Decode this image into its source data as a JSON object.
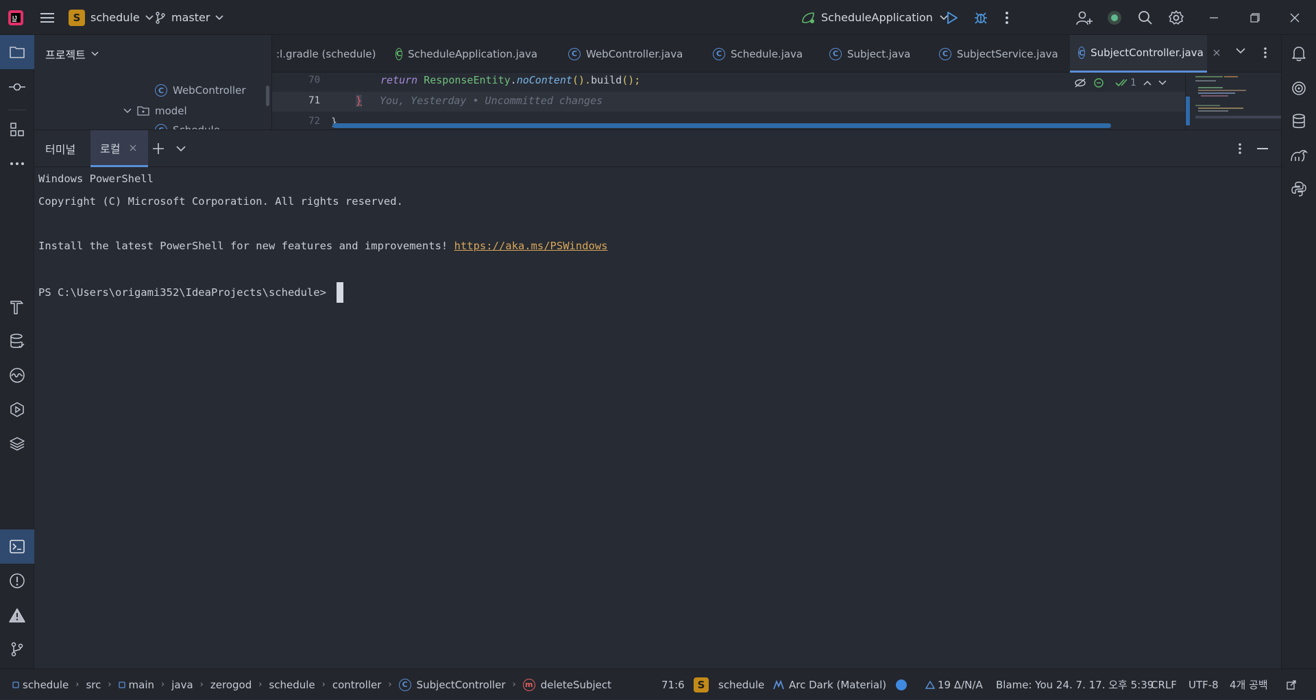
{
  "titlebar": {
    "project_badge": "S",
    "project_name": "schedule",
    "branch": "master",
    "run_config": "ScheduleApplication",
    "icons": [
      "app-logo-icon",
      "hamburger-menu-icon",
      "chevron-down-icon",
      "branch-icon",
      "run-config-icon",
      "run-icon",
      "debug-icon",
      "more-icon",
      "add-user-icon",
      "ai-assistant-icon",
      "search-icon",
      "settings-icon",
      "minimize-icon",
      "restore-icon",
      "close-icon"
    ]
  },
  "project_pane": {
    "title": "프로젝트",
    "tree": [
      {
        "label": "WebController",
        "kind": "class"
      },
      {
        "label": "model",
        "kind": "folder"
      },
      {
        "label": "Schedule",
        "kind": "class"
      }
    ]
  },
  "editor": {
    "tabs": [
      {
        "label": ":l.gradle (schedule)",
        "kind": "gradle"
      },
      {
        "label": "ScheduleApplication.java",
        "kind": "spring"
      },
      {
        "label": "WebController.java",
        "kind": "class"
      },
      {
        "label": "Schedule.java",
        "kind": "class"
      },
      {
        "label": "Subject.java",
        "kind": "class"
      },
      {
        "label": "SubjectService.java",
        "kind": "class"
      },
      {
        "label": "SubjectController.java",
        "kind": "class",
        "active": true
      }
    ],
    "lines": [
      {
        "num": "70",
        "kw": "return",
        "cls": "ResponseEntity",
        "m1": "noContent",
        "rest": "().",
        "m2": "build",
        "end": "();"
      },
      {
        "num": "71",
        "brace": "}",
        "blame": "You, Yesterday • Uncommitted changes"
      },
      {
        "num": "72",
        "text": "}"
      }
    ],
    "inspection_count": "1"
  },
  "terminal": {
    "title": "터미널",
    "tab_label": "로컬",
    "lines": [
      "Windows PowerShell",
      "Copyright (C) Microsoft Corporation. All rights reserved.",
      "",
      "Install the latest PowerShell for new features and improvements! ",
      "",
      "PS C:\\Users\\origami352\\IdeaProjects\\schedule> "
    ],
    "link": "https://aka.ms/PSWindows"
  },
  "statusbar": {
    "breadcrumb": [
      "schedule",
      "src",
      "main",
      "java",
      "zerogod",
      "schedule",
      "controller",
      "SubjectController",
      "deleteSubject"
    ],
    "position": "71:6",
    "project_badge": "S",
    "project": "schedule",
    "theme": "Arc Dark (Material)",
    "vcs": "19 Δ/N/A",
    "blame": "Blame: You 24. 7. 17. 오후 5:39",
    "line_sep": "CRLF",
    "encoding": "UTF-8",
    "indent": "4개 공백"
  },
  "colors": {
    "accent": "#5b8fd6",
    "active_tab": "#2f4a6e",
    "link": "#d9a75a",
    "badge": "#c28a18"
  }
}
